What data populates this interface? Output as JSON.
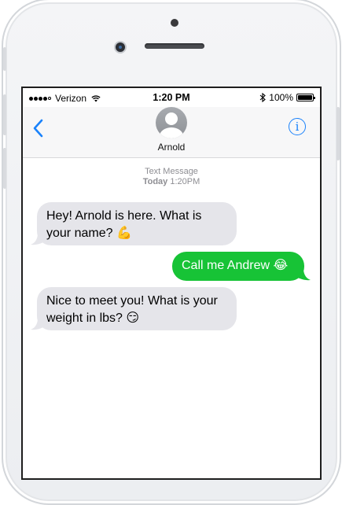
{
  "status_bar": {
    "carrier": "Verizon",
    "time": "1:20 PM",
    "battery": "100%",
    "signal_bars_filled": 4,
    "signal_bars_total": 5,
    "battery_level": 1.0
  },
  "nav": {
    "contact_name": "Arnold",
    "back_icon": "chevron-left-icon",
    "info_icon": "info-icon",
    "accent_color": "#1a82fb"
  },
  "thread": {
    "service_label": "Text Message",
    "day_label": "Today",
    "time_label": "1:20PM",
    "messages": [
      {
        "from": "contact",
        "text": "Hey! Arnold is here. What is your name? 💪"
      },
      {
        "from": "me",
        "text": "Call me Andrew 😂"
      },
      {
        "from": "contact",
        "text": "Nice to meet you! What is your weight in lbs? 😏"
      }
    ]
  },
  "colors": {
    "sent_bubble": "#17c336",
    "received_bubble": "#e5e5ea"
  }
}
